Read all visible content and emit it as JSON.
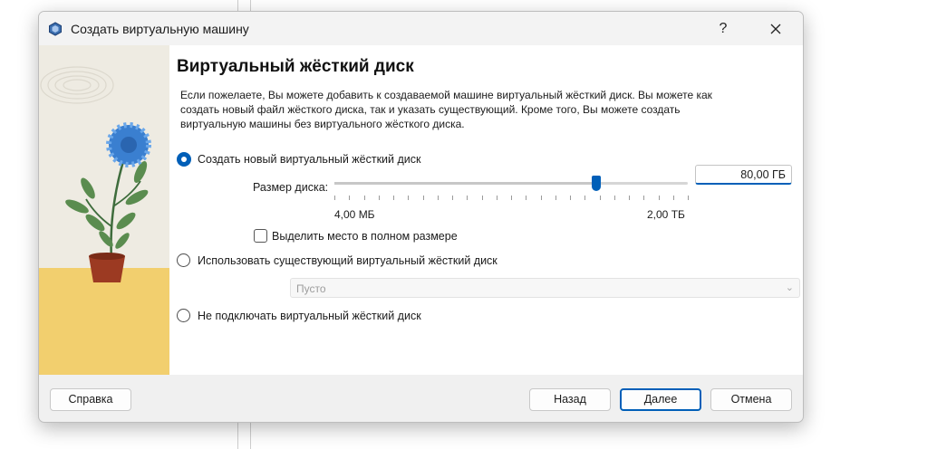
{
  "window": {
    "title": "Создать виртуальную машину",
    "help_label": "?"
  },
  "page": {
    "heading": "Виртуальный жёсткий диск",
    "description": "Если пожелаете, Вы можете добавить к создаваемой машине виртуальный жёсткий диск. Вы можете как создать новый файл жёсткого диска, так и указать существующий. Кроме того, Вы можете создать виртуальную машины без виртуального жёсткого диска."
  },
  "options": {
    "create_new": {
      "label": "Создать новый виртуальный жёсткий диск",
      "checked": true
    },
    "use_existing": {
      "label": "Использовать существующий виртуальный жёсткий диск",
      "checked": false
    },
    "no_disk": {
      "label": "Не подключать виртуальный жёсткий диск",
      "checked": false
    }
  },
  "disk_size": {
    "label": "Размер диска:",
    "value": "80,00 ГБ",
    "min_label": "4,00 МБ",
    "max_label": "2,00 ТБ",
    "slider_fraction": 0.74
  },
  "preallocate": {
    "label": "Выделить место в полном размере",
    "checked": false
  },
  "existing_disk": {
    "selected": "Пусто"
  },
  "buttons": {
    "help": "Справка",
    "back": "Назад",
    "next": "Далее",
    "cancel": "Отмена"
  },
  "colors": {
    "accent": "#005fb8",
    "dialog_bg": "#f0f0f0",
    "side_floor": "#f2cf6e"
  }
}
